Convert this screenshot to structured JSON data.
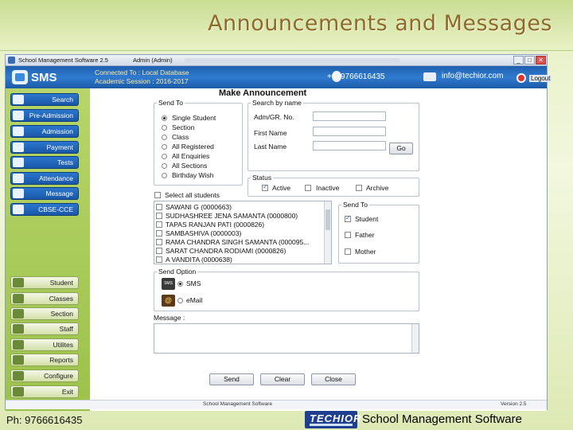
{
  "slide": {
    "title": "Announcements and Messages",
    "footer_phone": "Ph: 9766616435",
    "footer_logo": "TECHIOR",
    "footer_title": "School Management Software"
  },
  "window": {
    "title": "School Management Software 2.5",
    "user": "Admin (Admin)",
    "controls": [
      "_",
      "□",
      "✕"
    ]
  },
  "header": {
    "app_name": "SMS",
    "connected": "Connected To : Local Database",
    "session": "Academic Session : 2016-2017",
    "phone": "+919766616435",
    "email": "info@techior.com",
    "logout": "Logout"
  },
  "sidebar": {
    "top_items": [
      {
        "label": "Search",
        "icon": "search-icon"
      },
      {
        "label": "Pre-Admission",
        "icon": "pre-admission-icon"
      },
      {
        "label": "Admission",
        "icon": "admission-icon"
      },
      {
        "label": "Payment",
        "icon": "payment-icon"
      },
      {
        "label": "Tests",
        "icon": "tests-icon"
      },
      {
        "label": "Attendance",
        "icon": "attendance-icon"
      },
      {
        "label": "Message",
        "icon": "message-icon"
      },
      {
        "label": "CBSE-CCE",
        "icon": "cbse-icon"
      }
    ],
    "bottom_items": [
      {
        "label": "Student",
        "icon": "student-icon"
      },
      {
        "label": "Classes",
        "icon": "classes-icon"
      },
      {
        "label": "Section",
        "icon": "section-icon"
      },
      {
        "label": "Staff",
        "icon": "staff-icon"
      },
      {
        "label": "Utilites",
        "icon": "utilities-icon"
      },
      {
        "label": "Reports",
        "icon": "reports-icon"
      },
      {
        "label": "Configure",
        "icon": "configure-icon"
      },
      {
        "label": "Exit",
        "icon": "exit-icon"
      }
    ]
  },
  "form": {
    "title": "Make Announcement",
    "send_to": {
      "label": "Send To",
      "options": [
        "Single Student",
        "Section",
        "Class",
        "All Registered",
        "All Enquiries",
        "All Sections",
        "Birthday Wish"
      ],
      "selected": "Single Student"
    },
    "search_by_name": {
      "label": "Search by name",
      "adm_label": "Adm/GR. No.",
      "first_label": "First Name",
      "last_label": "Last Name",
      "go": "Go"
    },
    "status": {
      "label": "Status",
      "options": [
        {
          "label": "Active",
          "checked": true
        },
        {
          "label": "Inactive",
          "checked": false
        },
        {
          "label": "Archive",
          "checked": false
        }
      ]
    },
    "select_all": "Select all students",
    "students": [
      "SAWANI G (0000663)",
      "SUDHASHREE JENA SAMANTA (0000800)",
      "TAPAS RANJAN PATI (0000826)",
      "SAMBASHIVA (0000003)",
      "RAMA CHANDRA SINGH SAMANTA (000095...",
      "SARAT CHANDRA RODIAMI (0000826)",
      "A VANDITA (0000638)"
    ],
    "send_to_right": {
      "label": "Send To",
      "options": [
        {
          "label": "Student",
          "checked": true
        },
        {
          "label": "Father",
          "checked": false
        },
        {
          "label": "Mother",
          "checked": false
        }
      ]
    },
    "send_option": {
      "label": "Send Option",
      "sms": "SMS",
      "email": "eMail",
      "sms_badge": "SMS",
      "email_badge": "@"
    },
    "message_label": "Message :",
    "buttons": {
      "send": "Send",
      "clear": "Clear",
      "close": "Close"
    }
  },
  "status_bar": {
    "left": "School Management Software",
    "right": "Version 2.5"
  }
}
